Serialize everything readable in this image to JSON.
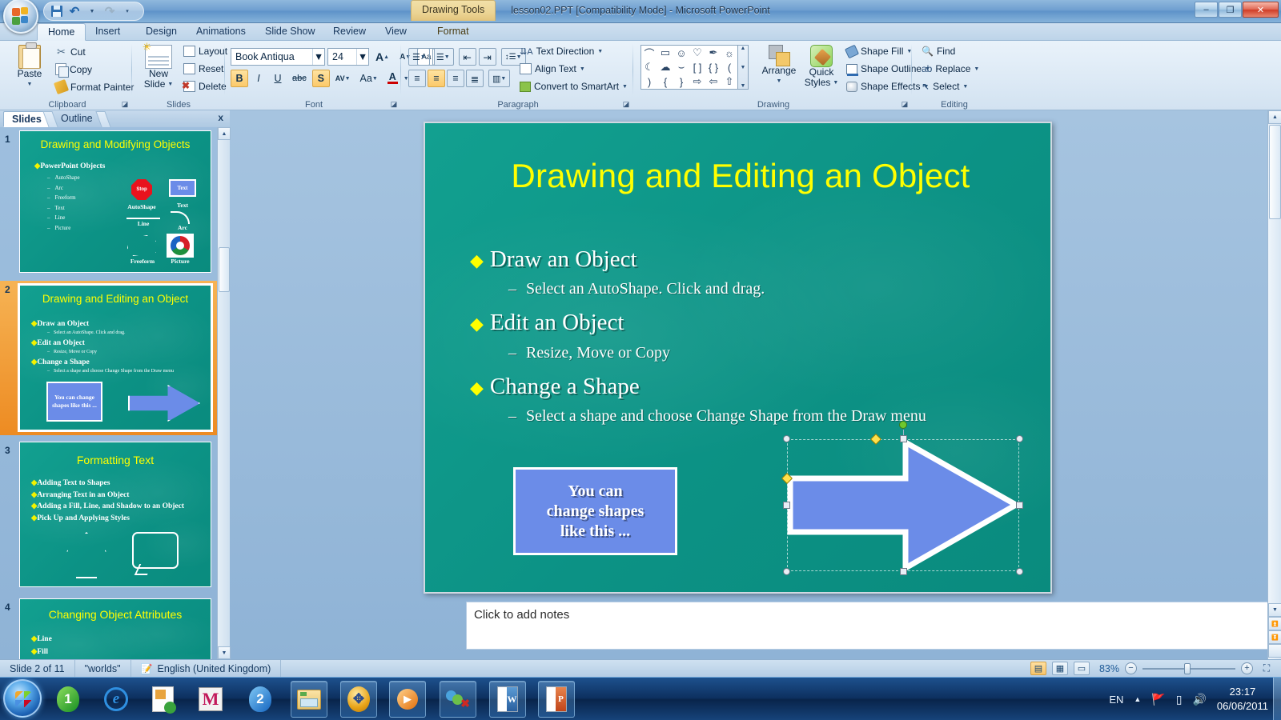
{
  "window": {
    "title": "lesson02.PPT [Compatibility Mode] - Microsoft PowerPoint",
    "context_tab_label": "Drawing Tools",
    "minimize": "–",
    "maximize": "❐",
    "close": "✕"
  },
  "quick_access": {
    "save": "save-icon",
    "undo": "↶",
    "redo": "↷",
    "customize": "▾"
  },
  "ribbon": {
    "tabs": [
      {
        "label": "Home",
        "active": true
      },
      {
        "label": "Insert",
        "active": false
      },
      {
        "label": "Design",
        "active": false
      },
      {
        "label": "Animations",
        "active": false
      },
      {
        "label": "Slide Show",
        "active": false
      },
      {
        "label": "Review",
        "active": false
      },
      {
        "label": "View",
        "active": false
      },
      {
        "label": "Format",
        "active": false,
        "contextual": true
      }
    ],
    "groups": {
      "clipboard": {
        "label": "Clipboard",
        "paste": "Paste",
        "cut": "Cut",
        "copy": "Copy",
        "format_painter": "Format Painter"
      },
      "slides": {
        "label": "Slides",
        "new_slide": "New",
        "new_slide_2": "Slide",
        "layout": "Layout",
        "reset": "Reset",
        "delete": "Delete"
      },
      "font": {
        "label": "Font",
        "font_name": "Book Antiqua",
        "font_size": "24",
        "grow": "A",
        "shrink": "A",
        "clear_formatting": "Aa",
        "bold": "B",
        "italic": "I",
        "underline": "U",
        "strikethrough": "abc",
        "shadow": "S",
        "character_spacing": "AV",
        "change_case": "Aa",
        "font_color": "A"
      },
      "paragraph": {
        "label": "Paragraph",
        "bullets": "☰",
        "numbering": "☰",
        "decrease_indent": "⇤",
        "increase_indent": "⇥",
        "line_spacing": "↕",
        "align_left": "≡",
        "align_center": "≡",
        "align_right": "≡",
        "justify": "≡",
        "columns": "‖",
        "text_direction": "Text Direction",
        "align_text": "Align Text",
        "convert_to_smartart": "Convert to SmartArt"
      },
      "drawing": {
        "label": "Drawing",
        "shapes": [
          "⌢",
          "▭",
          "☺",
          "♡",
          "✐",
          "☀",
          "☾",
          "☁",
          "⌒",
          "[ ]",
          "{ }",
          "(",
          ")",
          "{",
          "}",
          "⇨",
          "⇦",
          "⇧"
        ],
        "arrange": "Arrange",
        "quick_styles": "Quick",
        "quick_styles_2": "Styles",
        "shape_fill": "Shape Fill",
        "shape_outline": "Shape Outline",
        "shape_effects": "Shape Effects"
      },
      "editing": {
        "label": "Editing",
        "find": "Find",
        "replace": "Replace",
        "select": "Select"
      }
    }
  },
  "slides_pane": {
    "tab_slides": "Slides",
    "tab_outline": "Outline",
    "close": "x",
    "thumbnails": [
      {
        "number": "1",
        "title": "Drawing and Modifying Objects",
        "bullets": [
          "PowerPoint Objects"
        ],
        "sub_bullets": [
          "AutoShape",
          "Arc",
          "Freeform",
          "Text",
          "Line",
          "Picture"
        ],
        "shape_labels": [
          "AutoShape",
          "Text",
          "Line",
          "Arc",
          "Freeform",
          "Picture"
        ],
        "stop_label": "Stop",
        "text_label": "Text",
        "selected": false
      },
      {
        "number": "2",
        "title": "Drawing and Editing an Object",
        "bullets": [
          "Draw an Object",
          "Edit an Object",
          "Change a Shape"
        ],
        "sub_bullets": [
          "Select an AutoShape. Click and drag.",
          "Resize, Move or Copy",
          "Select a shape and choose Change Shape from the Draw menu"
        ],
        "textbox": "You can change shapes like this ...",
        "selected": true
      },
      {
        "number": "3",
        "title": "Formatting Text",
        "bullets": [
          "Adding Text to Shapes",
          "Arranging Text in an Object",
          "Adding a Fill, Line, and Shadow to an Object",
          "Pick Up and Applying Styles"
        ],
        "selected": false
      },
      {
        "number": "4",
        "title": "Changing Object Attributes",
        "bullets": [
          "Line",
          "Fill"
        ],
        "selected": false
      }
    ]
  },
  "slide": {
    "title": "Drawing and Editing an Object",
    "bullet_marker": "◆",
    "dash_marker": "–",
    "items": [
      {
        "heading": "Draw an Object",
        "sub": "Select an AutoShape. Click and drag."
      },
      {
        "heading": "Edit an Object",
        "sub": "Resize, Move or Copy"
      },
      {
        "heading": "Change a Shape",
        "sub": "Select a shape and choose Change Shape from the Draw menu"
      }
    ],
    "textbox_lines": [
      "You can",
      "change shapes",
      "like this ..."
    ],
    "selected_shape": "right-arrow",
    "colors": {
      "background": "#0c9285",
      "title_text": "#ffff00",
      "body_text": "#ffffff",
      "shape_fill": "#6b8ce8",
      "shape_outline": "#ffffff",
      "bullet_marker": "#f2f200"
    }
  },
  "notes": {
    "placeholder": "Click to add notes"
  },
  "status_bar": {
    "slide_counter": "Slide 2 of 11",
    "theme": "\"worlds\"",
    "language": "English (United Kingdom)",
    "zoom_level": "83%",
    "zoom_out": "−",
    "zoom_in": "+",
    "views": [
      "normal-view",
      "slide-sorter-view",
      "slide-show-view"
    ],
    "fit_to_window": "fit-slide-icon"
  },
  "taskbar": {
    "start": "start-orb",
    "items": [
      "windows-live-messenger",
      "internet-explorer",
      "powerpoint-viewer",
      "m-app",
      "app-2",
      "windows-explorer",
      "utility-app",
      "media-player",
      "contacts-app",
      "microsoft-word",
      "microsoft-powerpoint"
    ],
    "tray": {
      "language": "EN",
      "show_hidden": "▲",
      "network": "network-icon",
      "battery": "battery-icon",
      "volume": "volume-icon",
      "time": "23:17",
      "date": "06/06/2011"
    }
  }
}
